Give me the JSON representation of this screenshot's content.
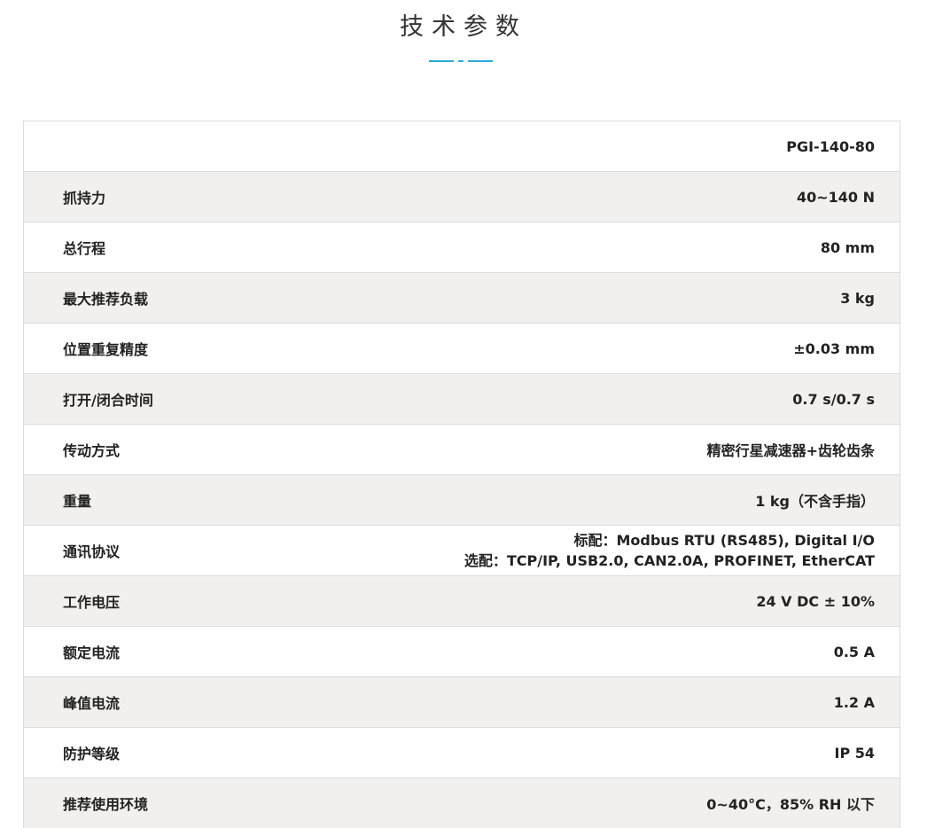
{
  "page": {
    "title": "技术参数",
    "accent_color": "#2aa9d8"
  },
  "table": {
    "header_value": "PGI-140-80",
    "rows": [
      {
        "label": "抓持力",
        "value": "40~140 N"
      },
      {
        "label": "总行程",
        "value": "80 mm"
      },
      {
        "label": "最大推荐负载",
        "value": "3 kg"
      },
      {
        "label": "位置重复精度",
        "value": "±0.03 mm"
      },
      {
        "label": "打开/闭合时间",
        "value": "0.7 s/0.7 s"
      },
      {
        "label": "传动方式",
        "value": "精密行星减速器+齿轮齿条"
      },
      {
        "label": "重量",
        "value": "1 kg（不含手指）"
      },
      {
        "label": "通讯协议",
        "value_lines": [
          "标配：Modbus RTU (RS485), Digital I/O",
          "选配：TCP/IP, USB2.0, CAN2.0A, PROFINET, EtherCAT"
        ]
      },
      {
        "label": "工作电压",
        "value": "24 V DC ± 10%"
      },
      {
        "label": "额定电流",
        "value": "0.5 A"
      },
      {
        "label": "峰值电流",
        "value": "1.2 A"
      },
      {
        "label": "防护等级",
        "value": "IP 54"
      },
      {
        "label": "推荐使用环境",
        "value": "0~40°C，85% RH 以下"
      }
    ]
  }
}
